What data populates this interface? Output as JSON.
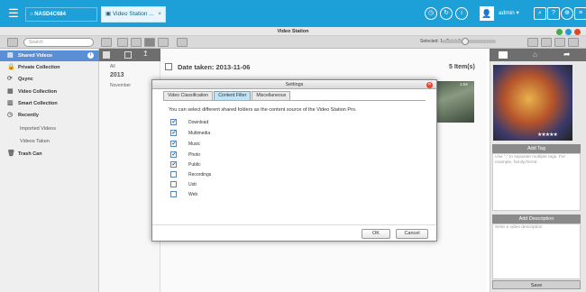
{
  "topbar": {
    "nas_name": "NASD4C684",
    "app_tab": "Video Station ...",
    "app_tab_close": "×",
    "user": "admin",
    "user_caret": "▾"
  },
  "window": {
    "title": "Video Station"
  },
  "toolbar": {
    "search_placeholder": "Search",
    "selection": "Selected: 1 , Total: 5"
  },
  "sidebar": {
    "items": [
      {
        "label": "Shared Videos",
        "icon": "folder-icon"
      },
      {
        "label": "Private Collection",
        "icon": "lock-icon"
      },
      {
        "label": "Qsync",
        "icon": "sync-icon"
      },
      {
        "label": "Video Collection",
        "icon": "collection-icon"
      },
      {
        "label": "Smart Collection",
        "icon": "smart-collection-icon"
      },
      {
        "label": "Recently",
        "icon": "clock-icon"
      },
      {
        "label": "Imported Videos"
      },
      {
        "label": "Videos Taken"
      },
      {
        "label": "Trash Can",
        "icon": "trash-icon"
      }
    ]
  },
  "timeline": {
    "all": "All",
    "year": "2013",
    "month": "November"
  },
  "main": {
    "date_header": "Date taken: 2013-11-06",
    "item_count": "5 Item(s)",
    "thumb_time": "1:04"
  },
  "right_panel": {
    "add_tag": "Add Tag",
    "tag_hint": "Use \",\" to separate multiple tags. For example, family,friend",
    "add_description": "Add Description",
    "description_hint": "Write a video description",
    "save": "Save",
    "stars": "★★★★★"
  },
  "dialog": {
    "title": "Settings",
    "tabs": [
      "Video Classification",
      "Content Filter",
      "Miscellaneous"
    ],
    "active_tab": "Content Filter",
    "description": "You can select different shared folders as the content source of the Video Station Pro.",
    "folders": [
      {
        "name": "Download",
        "checked": true
      },
      {
        "name": "Multimedia",
        "checked": true
      },
      {
        "name": "Music",
        "checked": true
      },
      {
        "name": "Photo",
        "checked": true
      },
      {
        "name": "Public",
        "checked": true
      },
      {
        "name": "Recordings",
        "checked": false
      },
      {
        "name": "Usb",
        "checked": false
      },
      {
        "name": "Web",
        "checked": false
      }
    ],
    "ok_label": "OK",
    "cancel_label": "Cancel"
  },
  "colors": {
    "accent": "#1d9fd8",
    "sidebar_active": "#5a8fd6",
    "close_red": "#e0452e"
  }
}
